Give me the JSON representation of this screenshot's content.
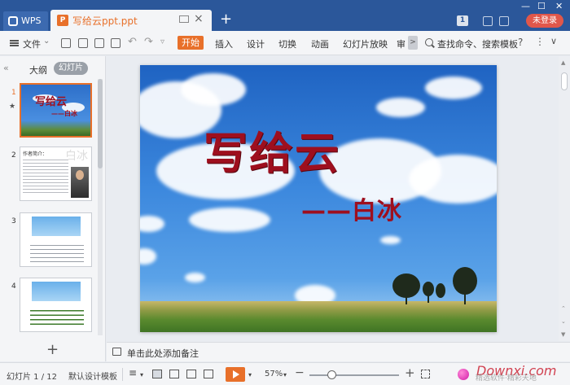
{
  "titlebar": {
    "app_tab": "WPS",
    "doc_title": "写给云ppt.ppt",
    "new_tab": "+",
    "badge": "1",
    "login": "未登录",
    "minimize": "—",
    "maximize": "☐",
    "close": "✕"
  },
  "ribbon": {
    "file_menu": "文件",
    "start_tab": "开始",
    "tabs": [
      "插入",
      "设计",
      "切换",
      "动画",
      "幻灯片放映",
      "审"
    ],
    "more": ">",
    "search": "查找命令、搜索模板",
    "help": "?",
    "more_dots": "⋮",
    "collapse": "∨"
  },
  "left_panel": {
    "tab_outline": "大纲",
    "tab_slides": "幻灯片",
    "slides": [
      {
        "num": "1",
        "title": "写给云",
        "subtitle": "——白冰"
      },
      {
        "num": "2",
        "title": "作者简介：",
        "badge_text": "白冰"
      },
      {
        "num": "3"
      },
      {
        "num": "4"
      }
    ],
    "add_slide": "+"
  },
  "slide": {
    "title": "写给云",
    "subtitle": "——白冰"
  },
  "notes": {
    "placeholder": "单击此处添加备注"
  },
  "statusbar": {
    "slide_counter": "幻灯片 1 / 12",
    "template": "默认设计模板",
    "zoom": "57%",
    "zoom_level_percent": 57,
    "watermark": "Downxi.com",
    "watermark_sub": "精选软件·精彩天地"
  },
  "colors": {
    "accent": "#e8702a",
    "titlebar": "#2b579a",
    "slide_title": "#9e0f1e",
    "login": "#e0574a"
  }
}
